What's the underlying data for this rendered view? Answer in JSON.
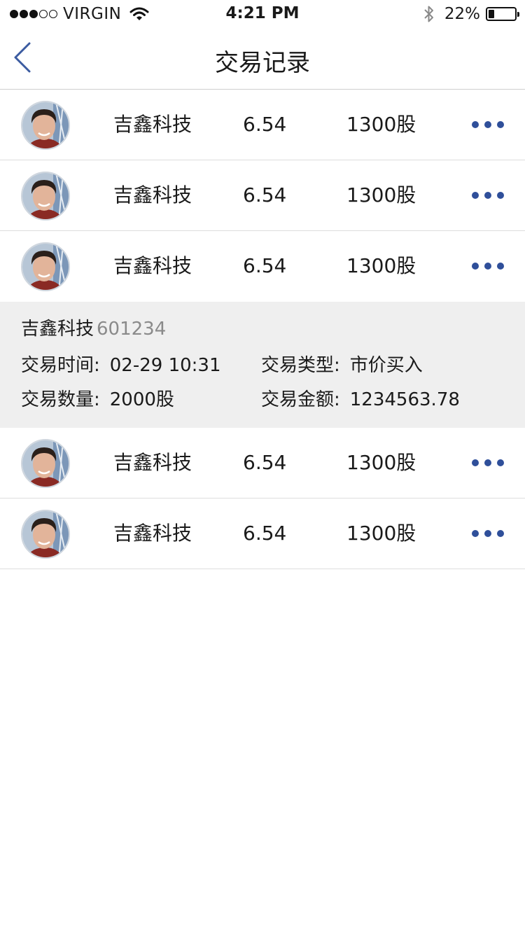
{
  "status_bar": {
    "carrier": "VIRGIN",
    "time": "4:21 PM",
    "battery": "22%",
    "battery_level": 0.22
  },
  "nav": {
    "title": "交易记录",
    "back_icon": "chevron-left-icon"
  },
  "accent_color": "#2f4f9a",
  "rows": [
    {
      "name": "吉鑫科技",
      "price": "6.54",
      "quantity": "1300股"
    },
    {
      "name": "吉鑫科技",
      "price": "6.54",
      "quantity": "1300股"
    },
    {
      "name": "吉鑫科技",
      "price": "6.54",
      "quantity": "1300股"
    }
  ],
  "detail": {
    "name": "吉鑫科技",
    "code": "601234",
    "time_label": "交易时间:",
    "time_value": "02-29 10:31",
    "type_label": "交易类型:",
    "type_value": "市价买入",
    "qty_label": "交易数量:",
    "qty_value": "2000股",
    "amount_label": "交易金额:",
    "amount_value": "1234563.78"
  },
  "rows_after": [
    {
      "name": "吉鑫科技",
      "price": "6.54",
      "quantity": "1300股"
    },
    {
      "name": "吉鑫科技",
      "price": "6.54",
      "quantity": "1300股"
    }
  ]
}
